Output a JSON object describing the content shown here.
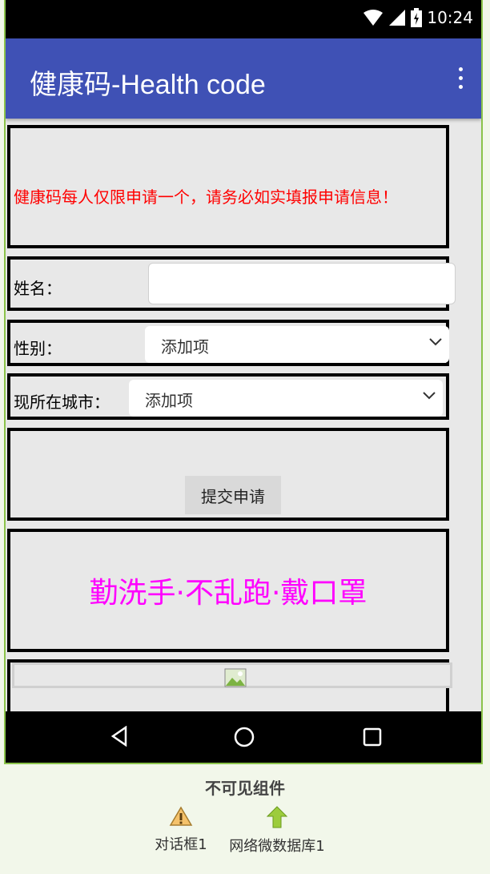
{
  "status": {
    "time": "10:24"
  },
  "appbar": {
    "title": "健康码-Health code"
  },
  "notice": {
    "text": "健康码每人仅限申请一个，请务必如实填报申请信息！",
    "color": "#ff0000"
  },
  "form": {
    "name_label": "姓名：",
    "name_value": "",
    "gender_label": "性别：",
    "gender_selected": "添加项",
    "city_label": "现所在城市：",
    "city_selected": "添加项",
    "submit_label": "提交申请"
  },
  "slogan": {
    "text": "勤洗手·不乱跑·戴口罩",
    "color": "#ff00ff"
  },
  "nonvisible": {
    "title": "不可见组件",
    "components": [
      {
        "label": "对话框1",
        "icon": "warning-icon"
      },
      {
        "label": "网络微数据库1",
        "icon": "upload-arrow-icon"
      }
    ]
  },
  "colors": {
    "appbar": "#3f51b5",
    "frame": "#8bc34a"
  }
}
